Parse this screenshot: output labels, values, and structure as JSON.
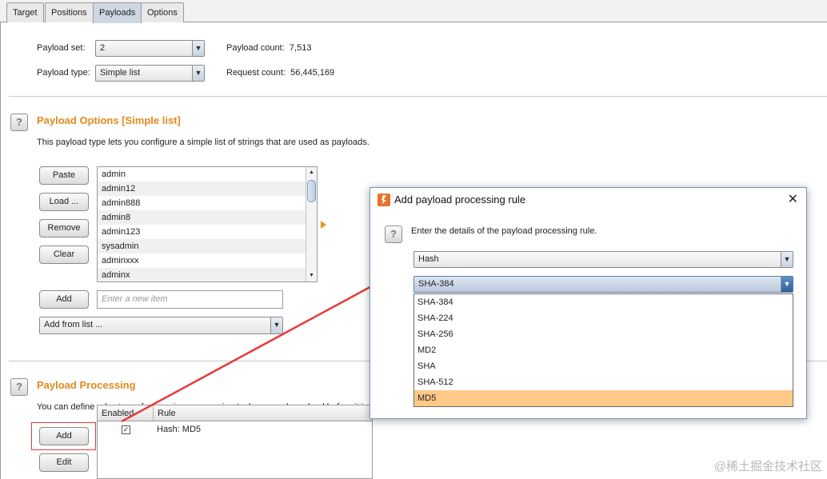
{
  "tabs": [
    {
      "label": "Target"
    },
    {
      "label": "Positions"
    },
    {
      "label": "Payloads"
    },
    {
      "label": "Options"
    }
  ],
  "active_tab": "Payloads",
  "payload_set": {
    "label": "Payload set:",
    "value": "2"
  },
  "payload_type": {
    "label": "Payload type:",
    "value": "Simple list"
  },
  "payload_count": {
    "label": "Payload count:",
    "value": "7,513"
  },
  "request_count": {
    "label": "Request count:",
    "value": "56,445,169"
  },
  "payload_options": {
    "title": "Payload Options [Simple list]",
    "description": "This payload type lets you configure a simple list of strings that are used as payloads.",
    "buttons": {
      "paste": "Paste",
      "load": "Load ...",
      "remove": "Remove",
      "clear": "Clear",
      "add": "Add"
    },
    "items": [
      "admin",
      "admin12",
      "admin888",
      "admin8",
      "admin123",
      "sysadmin",
      "adminxxx",
      "adminx"
    ],
    "new_item_placeholder": "Enter a new item",
    "add_from_list": "Add from list ..."
  },
  "payload_processing": {
    "title": "Payload Processing",
    "description": "You can define rules to perform various processing tasks on each payload before it is",
    "buttons": {
      "add": "Add",
      "edit": "Edit"
    },
    "columns": {
      "enabled": "Enabled",
      "rule": "Rule"
    },
    "rules": [
      {
        "enabled": true,
        "rule": "Hash: MD5"
      }
    ]
  },
  "dialog": {
    "title": "Add payload processing rule",
    "instruction": "Enter the details of the payload processing rule.",
    "rule_type": "Hash",
    "hash_selected": "SHA-384",
    "hash_options": [
      "SHA-384",
      "SHA-224",
      "SHA-256",
      "MD2",
      "SHA",
      "SHA-512",
      "MD5"
    ],
    "highlighted_option": "MD5"
  },
  "annotation_color": "#e8393a",
  "watermark": "@稀土掘金技术社区"
}
